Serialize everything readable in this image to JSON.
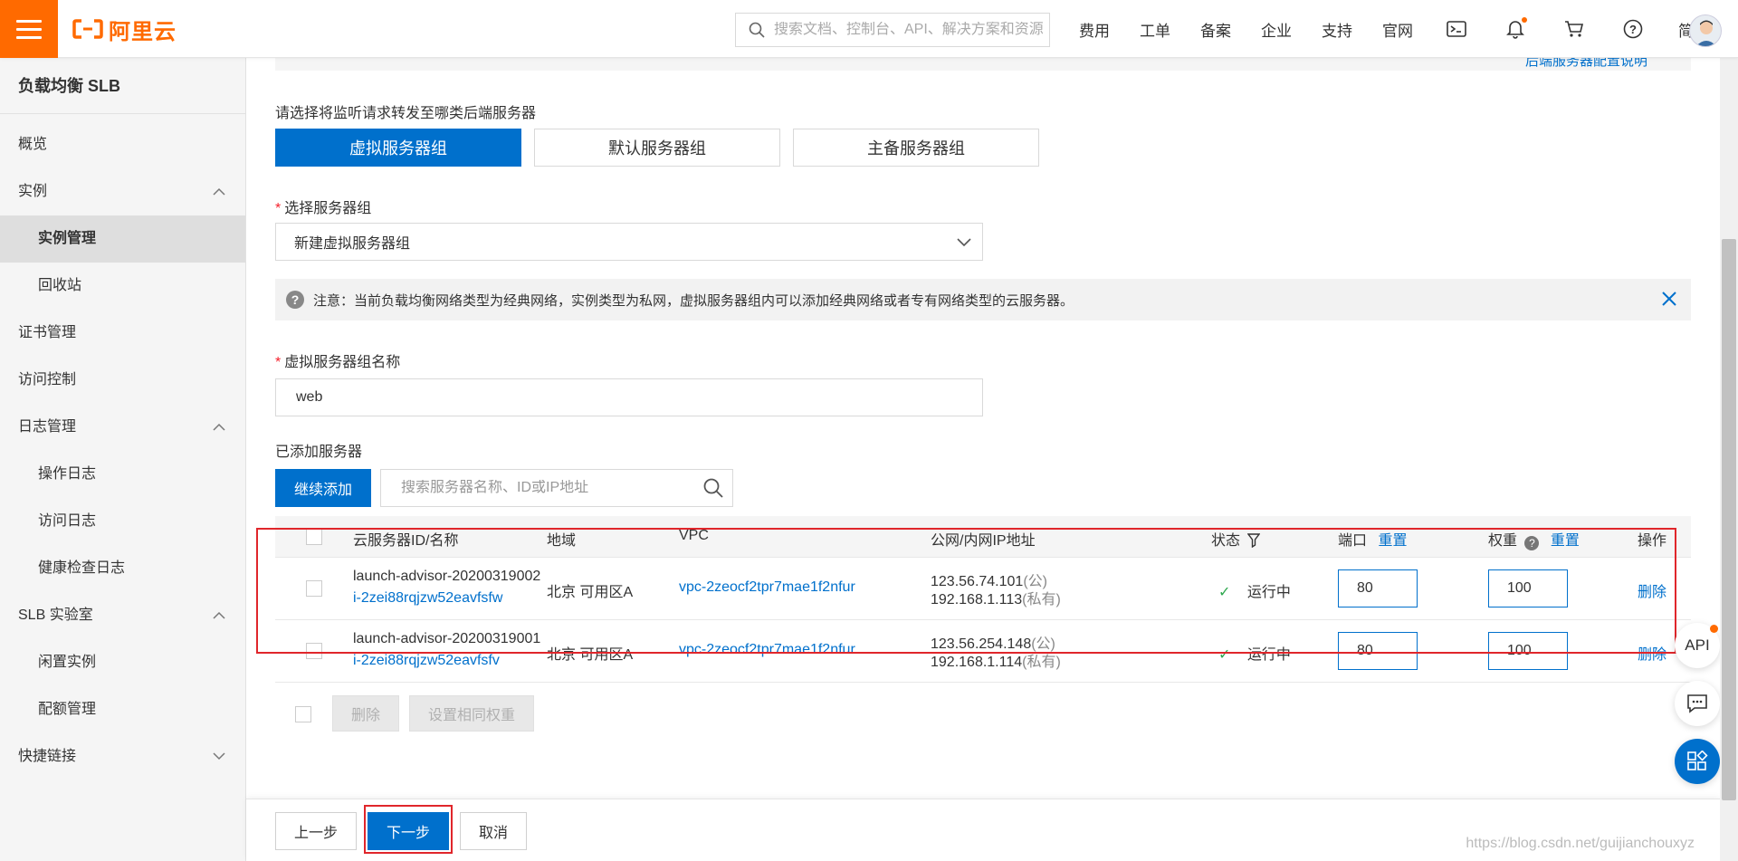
{
  "brand": {
    "logo_text": "阿里云",
    "accent": "#ff6a00",
    "primary": "#0070cc"
  },
  "header": {
    "search_placeholder": "搜索文档、控制台、API、解决方案和资源",
    "nav": [
      "费用",
      "工单",
      "备案",
      "企业",
      "支持",
      "官网"
    ],
    "lang": "简体"
  },
  "sidebar": {
    "title": "负载均衡 SLB",
    "items": [
      {
        "label": "概览"
      },
      {
        "label": "实例"
      },
      {
        "label": "实例管理"
      },
      {
        "label": "回收站"
      },
      {
        "label": "证书管理"
      },
      {
        "label": "访问控制"
      },
      {
        "label": "日志管理"
      },
      {
        "label": "操作日志"
      },
      {
        "label": "访问日志"
      },
      {
        "label": "健康检查日志"
      },
      {
        "label": "SLB 实验室"
      },
      {
        "label": "闲置实例"
      },
      {
        "label": "配额管理"
      },
      {
        "label": "快捷链接"
      }
    ]
  },
  "form": {
    "top_link": "后端服务器配置说明",
    "forward_label": "请选择将监听请求转发至哪类后端服务器",
    "server_tabs": [
      "虚拟服务器组",
      "默认服务器组",
      "主备服务器组"
    ],
    "select_group_label": "选择服务器组",
    "select_group_value": "新建虚拟服务器组",
    "notice": "注意：当前负载均衡网络类型为经典网络，实例类型为私网，虚拟服务器组内可以添加经典网络或者专有网络类型的云服务器。",
    "group_name_label": "虚拟服务器组名称",
    "group_name_value": "web",
    "added_label": "已添加服务器",
    "continue_add": "继续添加",
    "server_search_placeholder": "搜索服务器名称、ID或IP地址"
  },
  "table": {
    "headers": {
      "id_name": "云服务器ID/名称",
      "region": "地域",
      "vpc": "VPC",
      "ip": "公网/内网IP地址",
      "status": "状态",
      "port": "端口",
      "port_reset": "重置",
      "weight": "权重",
      "weight_reset": "重置",
      "action": "操作"
    },
    "rows": [
      {
        "name": "launch-advisor-20200319002",
        "id": "i-2zei88rqjzw52eavfsfw",
        "region": "北京 可用区A",
        "vpc": "vpc-2zeocf2tpr7mae1f2nfur",
        "public_ip": "123.56.74.101",
        "public_tag": "(公)",
        "private_ip": "192.168.1.113",
        "private_tag": "(私有)",
        "status": "运行中",
        "port": "80",
        "weight": "100",
        "action": "删除"
      },
      {
        "name": "launch-advisor-20200319001",
        "id": "i-2zei88rqjzw52eavfsfv",
        "region": "北京 可用区A",
        "vpc": "vpc-2zeocf2tpr7mae1f2nfur",
        "public_ip": "123.56.254.148",
        "public_tag": "(公)",
        "private_ip": "192.168.1.114",
        "private_tag": "(私有)",
        "status": "运行中",
        "port": "80",
        "weight": "100",
        "action": "删除"
      }
    ],
    "bulk_delete": "删除",
    "bulk_weight": "设置相同权重"
  },
  "footer": {
    "prev": "上一步",
    "next": "下一步",
    "cancel": "取消",
    "watermark": "https://blog.csdn.net/guijianchouxyz"
  },
  "float": {
    "api_label": "API"
  }
}
